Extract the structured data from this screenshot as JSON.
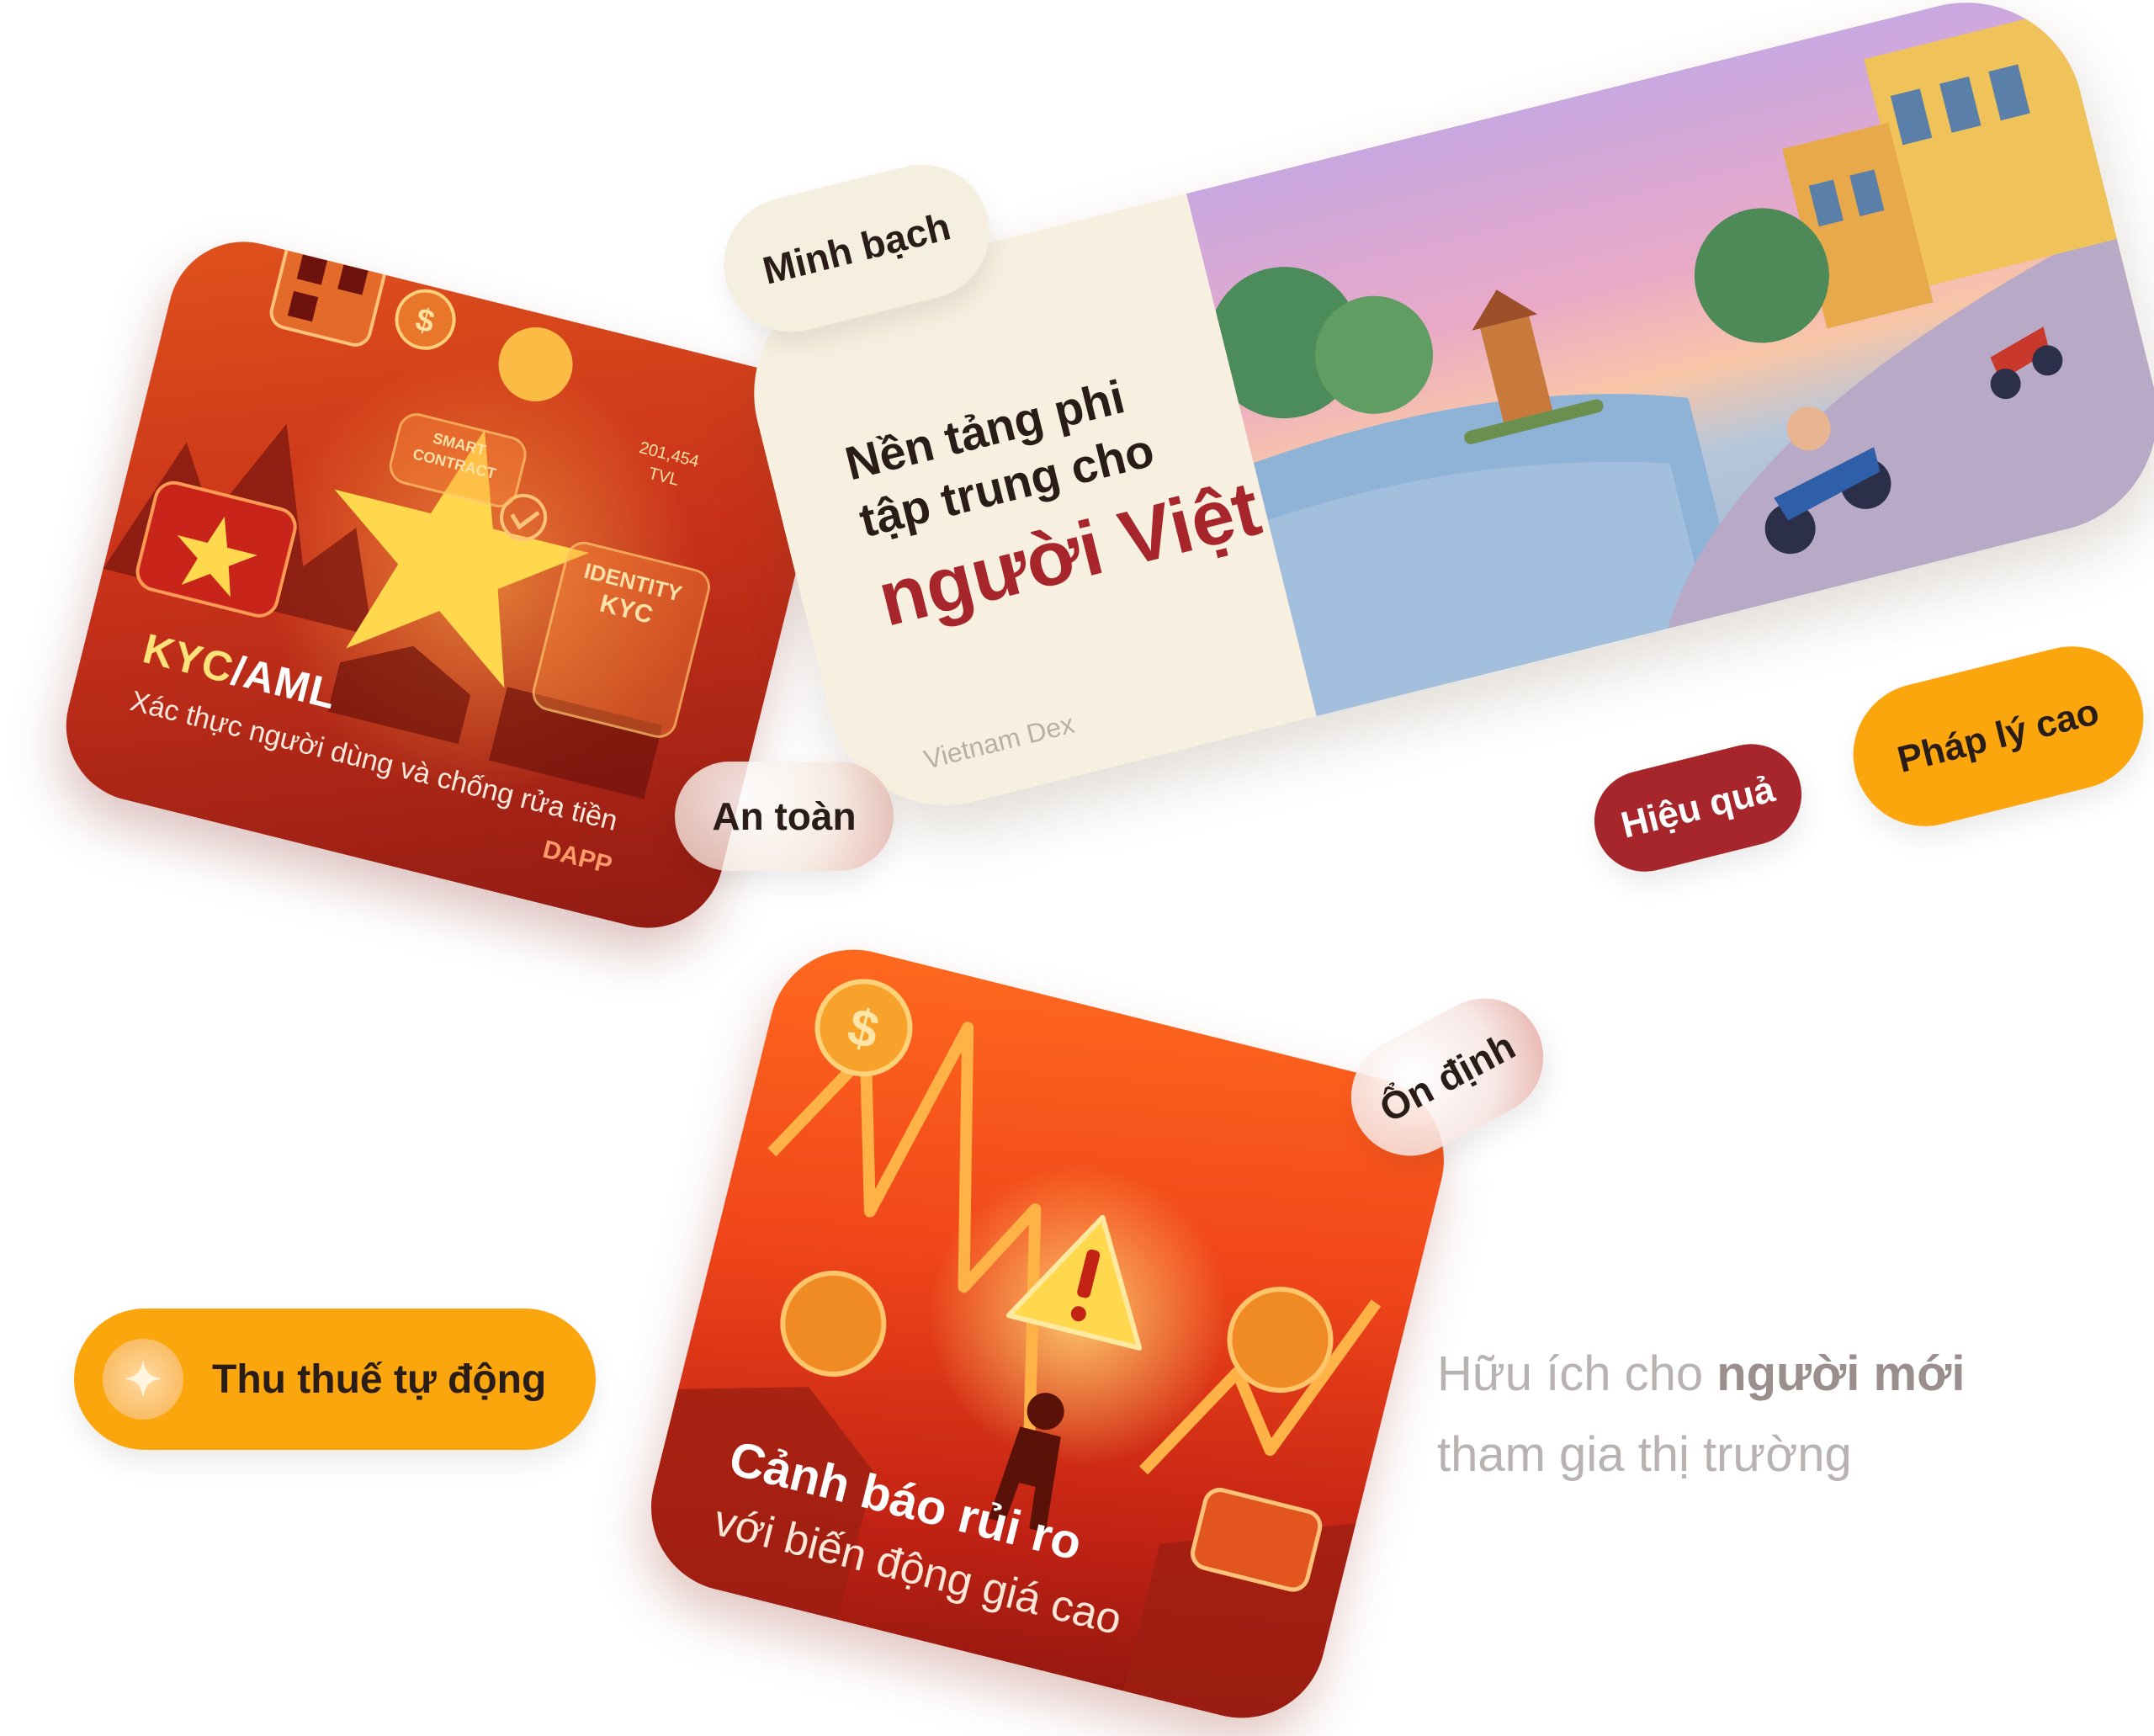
{
  "kyc_card": {
    "title_a": "KYC",
    "title_b": "/AML",
    "subtitle": "Xác thực người dùng và chống rửa tiền",
    "tiles": {
      "smart_contract": "SMART CONTRACT",
      "tvl_value": "201,454",
      "tvl_label": "TVL",
      "identity": "IDENTITY",
      "kyc": "KYC",
      "dapp": "DAPP"
    }
  },
  "main_card": {
    "headline_line1": "Nền tảng phi",
    "headline_line2": "tập trung cho",
    "headline_accent": "người Việt",
    "brand": "Vietnam Dex"
  },
  "risk_card": {
    "title": "Cảnh báo rủi ro",
    "subtitle": "với biến động giá cao"
  },
  "pills": {
    "minh_bach": "Minh bạch",
    "an_toan": "An toàn",
    "hieu_qua": "Hiệu quả",
    "phap_ly": "Pháp lý cao",
    "on_dinh": "Ổn định",
    "thu_thue": "Thu thuế tự động"
  },
  "tagline": {
    "part1": "Hữu ích cho ",
    "bold": "người mới",
    "part2": "tham gia thị trường"
  },
  "colors": {
    "brand_red": "#a7262b",
    "brand_orange": "#fca60d",
    "cream": "#f6efe0"
  },
  "icons": {
    "thue_pill": "sparkle-icon",
    "risk_card": "warning-icon"
  }
}
